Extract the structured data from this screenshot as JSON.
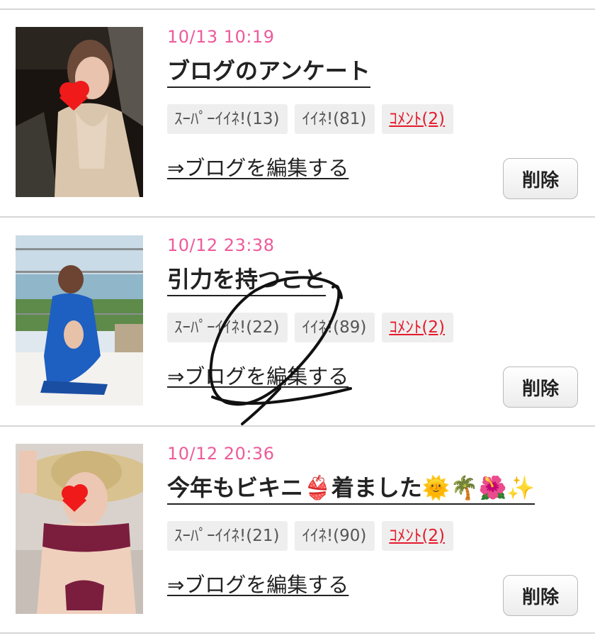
{
  "posts": [
    {
      "date": "10/13 10:19",
      "title": "ブログのアンケート",
      "super_like": "ｽｰﾊﾟｰｲｲﾈ!(13)",
      "like": "ｲｲﾈ!(81)",
      "comment": "ｺﾒﾝﾄ(2)",
      "edit": "⇒ブログを編集する",
      "delete": "削除"
    },
    {
      "date": "10/12 23:38",
      "title": "引力を持つこと",
      "super_like": "ｽｰﾊﾟｰｲｲﾈ!(22)",
      "like": "ｲｲﾈ!(89)",
      "comment": "ｺﾒﾝﾄ(2)",
      "edit": "⇒ブログを編集する",
      "delete": "削除"
    },
    {
      "date": "10/12 20:36",
      "title": "今年もビキニ👙着ました🌞🌴🌺✨",
      "super_like": "ｽｰﾊﾟｰｲｲﾈ!(21)",
      "like": "ｲｲﾈ!(90)",
      "comment": "ｺﾒﾝﾄ(2)",
      "edit": "⇒ブログを編集する",
      "delete": "削除"
    }
  ],
  "colors": {
    "date": "#ee5a9b",
    "comment": "#e41a2b",
    "divider": "#d6d6d6"
  }
}
